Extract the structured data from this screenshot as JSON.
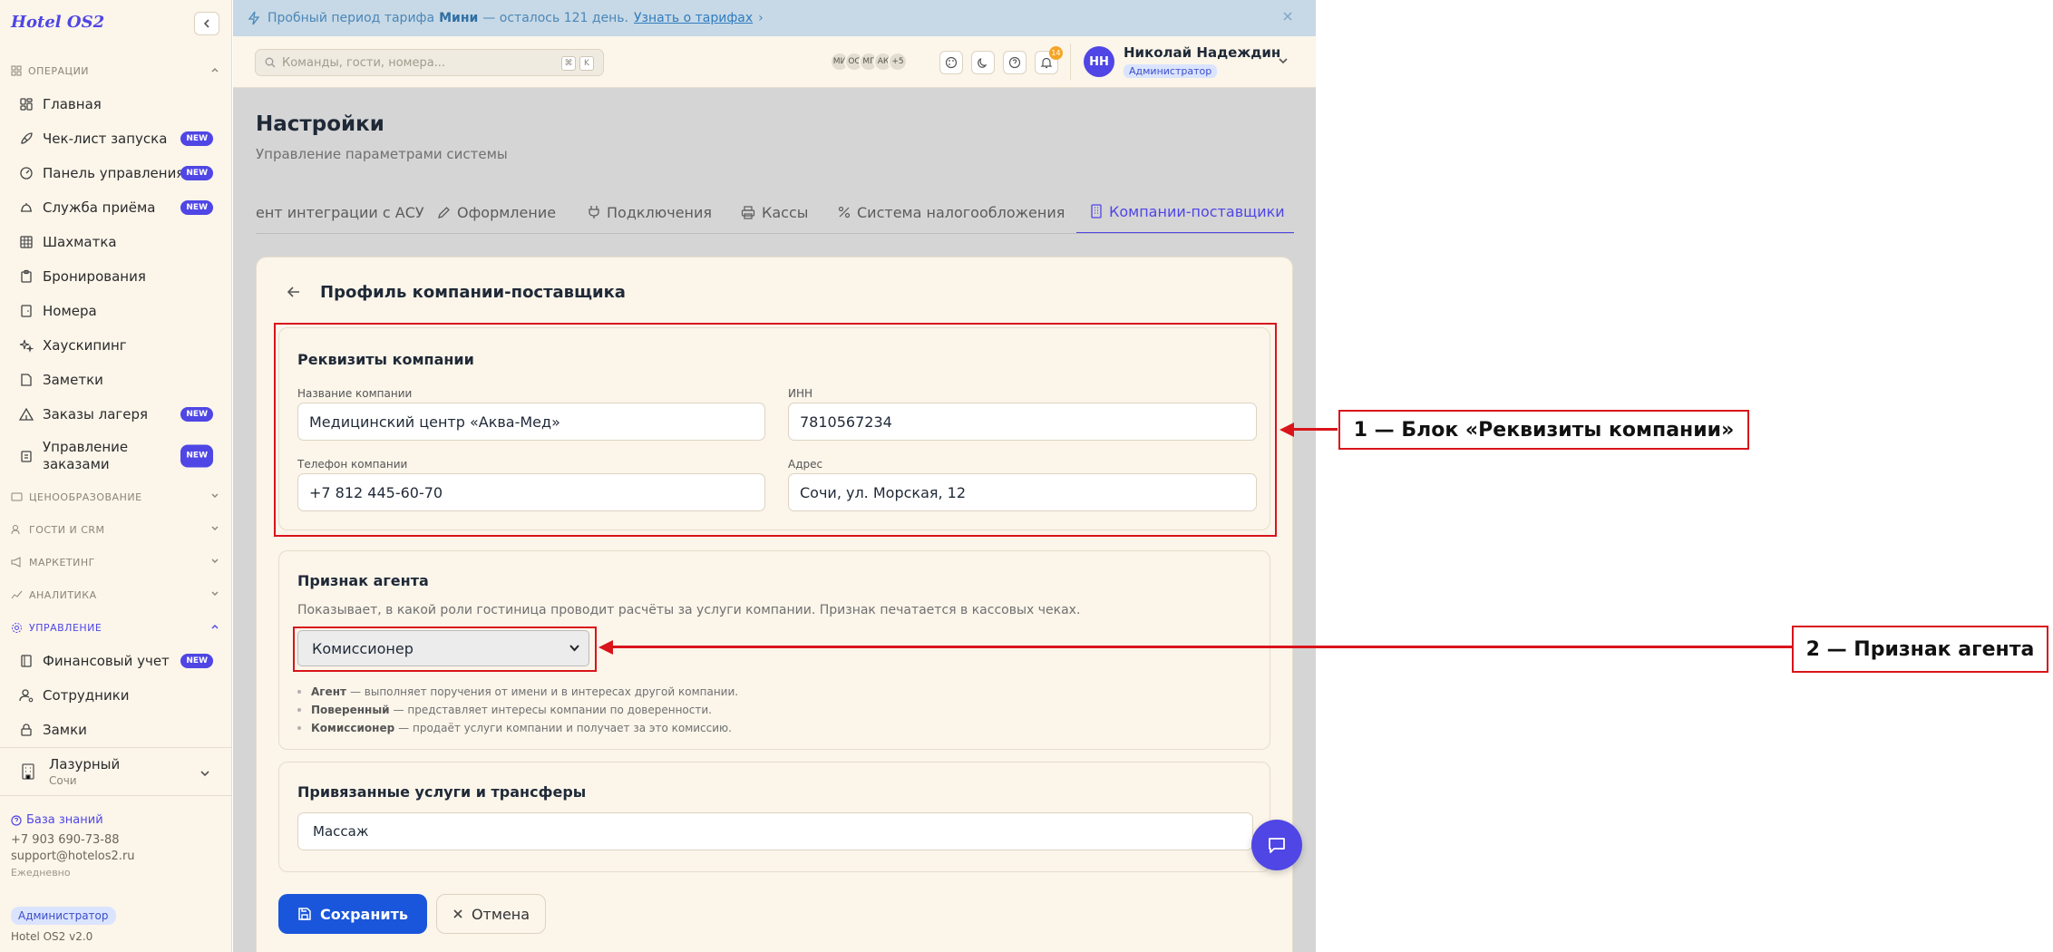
{
  "brand": "Hotel OS2",
  "sidebar": {
    "operations_label": "Операции",
    "items": [
      {
        "label": "Главная"
      },
      {
        "label": "Чек-лист запуска",
        "badge": "NEW"
      },
      {
        "label": "Панель управления",
        "badge": "NEW"
      },
      {
        "label": "Служба приёма",
        "badge": "NEW"
      },
      {
        "label": "Шахматка"
      },
      {
        "label": "Бронирования"
      },
      {
        "label": "Номера"
      },
      {
        "label": "Хаускипинг"
      },
      {
        "label": "Заметки"
      },
      {
        "label": "Заказы лагеря",
        "badge": "NEW"
      },
      {
        "label": "Управление заказами",
        "badge": "NEW"
      }
    ],
    "sections": [
      "Ценообразование",
      "Гости и CRM",
      "Маркетинг",
      "Аналитика"
    ],
    "management_label": "Управление",
    "management_items": [
      {
        "label": "Финансовый учет",
        "badge": "NEW"
      },
      {
        "label": "Сотрудники"
      },
      {
        "label": "Замки"
      }
    ],
    "hotel": {
      "name": "Лазурный",
      "city": "Сочи"
    },
    "support": {
      "kb_label": "База знаний",
      "phone": "+7 903 690-73-88",
      "email": "support@hotelos2.ru",
      "hours": "Ежедневно"
    },
    "role": "Администратор",
    "version": "Hotel OS2 v2.0"
  },
  "trial": {
    "prefix": "Пробный период тарифа",
    "plan": "Мини",
    "suffix": "— осталось 121 день.",
    "link": "Узнать о тарифах",
    "link_arrow": "›"
  },
  "topbar": {
    "search_placeholder": "Команды, гости, номера...",
    "kbd1": "⌘",
    "kbd2": "K",
    "avatars": [
      "МИ",
      "ОС",
      "МГ",
      "АК"
    ],
    "avatars_more": "+5",
    "notif_count": "14",
    "user": {
      "initials": "НН",
      "name": "Николай Надеждин",
      "role": "Администратор"
    }
  },
  "page": {
    "title": "Настройки",
    "subtitle": "Управление параметрами системы",
    "tabs": [
      {
        "label": "ент интеграции с АСУ"
      },
      {
        "label": "Оформление"
      },
      {
        "label": "Подключения"
      },
      {
        "label": "Кассы"
      },
      {
        "label": "Система налогообложения"
      },
      {
        "label": "Компании-поставщики",
        "active": true
      }
    ]
  },
  "profile": {
    "title": "Профиль компании-поставщика",
    "requisites": {
      "title": "Реквизиты компании",
      "name_label": "Название компании",
      "name_value": "Медицинский центр «Аква-Мед»",
      "inn_label": "ИНН",
      "inn_value": "7810567234",
      "phone_label": "Телефон компании",
      "phone_value": "+7 812 445-60-70",
      "address_label": "Адрес",
      "address_value": "Сочи, ул. Морская, 12"
    },
    "agent": {
      "title": "Признак агента",
      "hint": "Показывает, в какой роли гостиница проводит расчёты за услуги компании. Признак печатается в кассовых чеках.",
      "selected": "Комиссионер",
      "defs": [
        {
          "term": "Агент",
          "text": "— выполняет поручения от имени и в интересах другой компании."
        },
        {
          "term": "Поверенный",
          "text": "— представляет интересы компании по доверенности."
        },
        {
          "term": "Комиссионер",
          "text": "— продаёт услуги компании и получает за это комиссию."
        }
      ]
    },
    "services": {
      "title": "Привязанные услуги и трансферы",
      "value": "Массаж"
    },
    "save_label": "Сохранить",
    "cancel_label": "Отмена"
  },
  "annotations": {
    "a1": "1 — Блок «Реквизиты компании»",
    "a2": "2 — Признак агента"
  },
  "colors": {
    "accent": "#4f46e5",
    "primary_button": "#1a56db",
    "annotation": "#d9141b"
  }
}
